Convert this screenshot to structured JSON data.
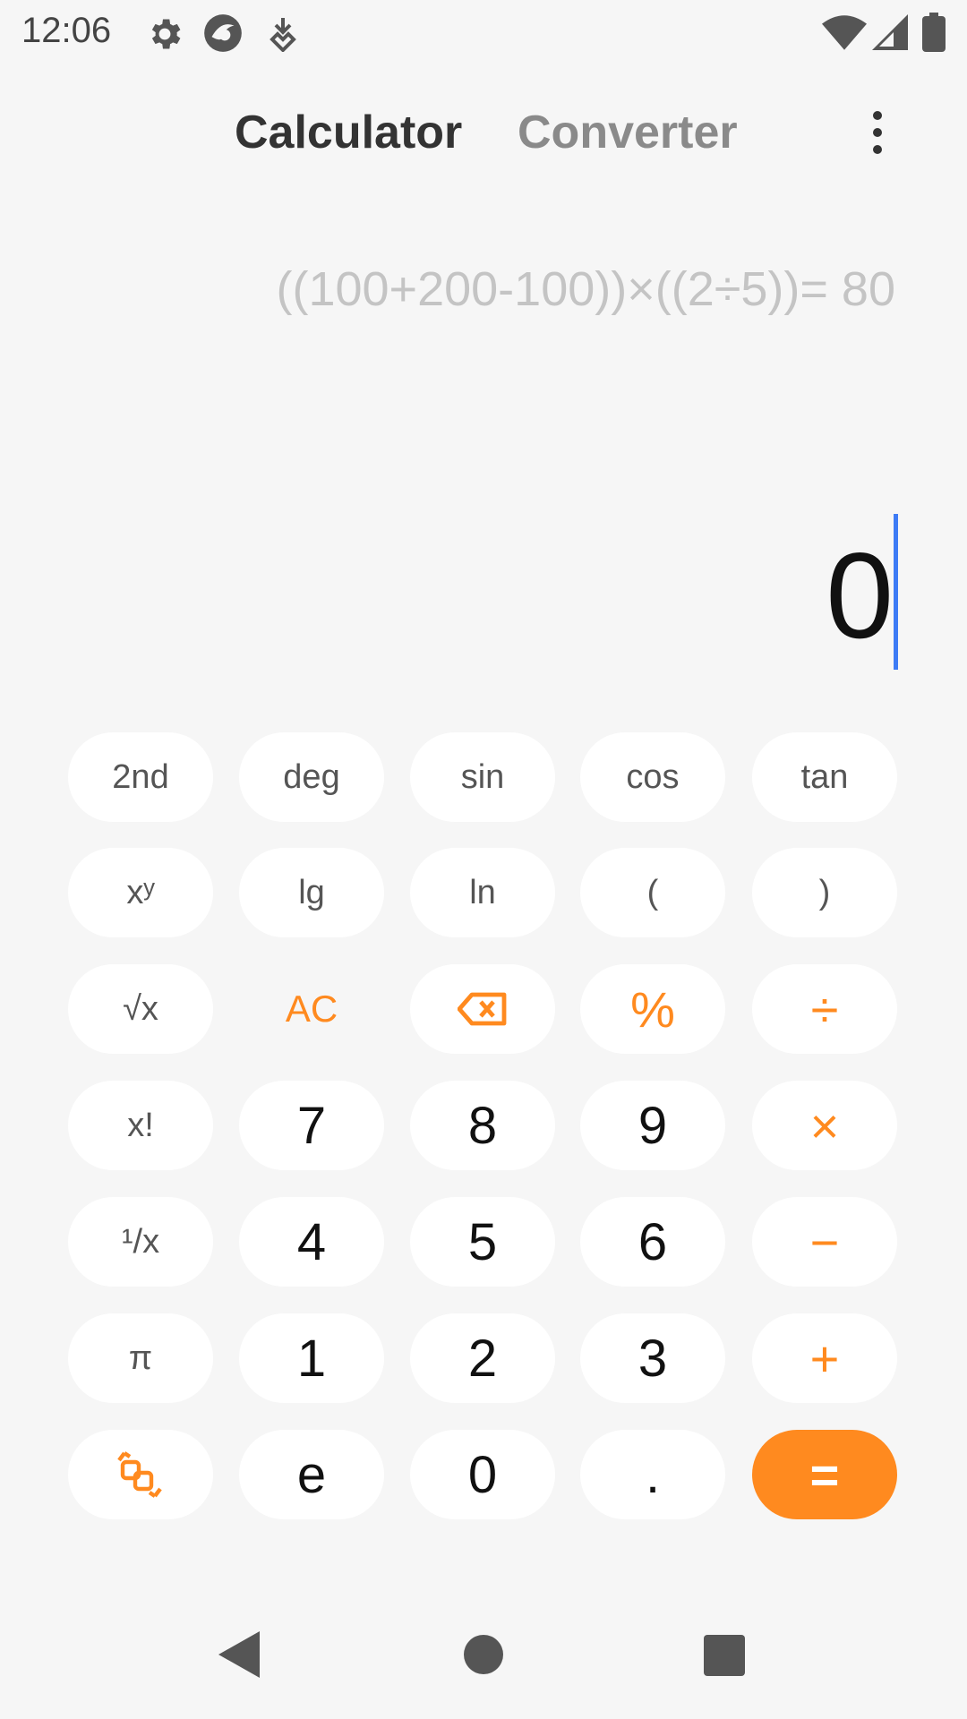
{
  "status_bar": {
    "time": "12:06",
    "icons": [
      "gear-icon",
      "browser-icon",
      "download-icon",
      "wifi-icon",
      "signal-icon",
      "battery-icon"
    ]
  },
  "tabs": [
    {
      "label": "Calculator",
      "active": true
    },
    {
      "label": "Converter",
      "active": false
    }
  ],
  "display": {
    "history": "((100+200-100))×((2÷5))= 80",
    "result": "0"
  },
  "keypad": {
    "rows": [
      [
        "2nd",
        "deg",
        "sin",
        "cos",
        "tan"
      ],
      [
        "xʸ",
        "lg",
        "ln",
        "(",
        ")"
      ],
      [
        "√x",
        "AC",
        "⌫",
        "%",
        "÷"
      ],
      [
        "x!",
        "7",
        "8",
        "9",
        "×"
      ],
      [
        "¹/x",
        "4",
        "5",
        "6",
        "−"
      ],
      [
        "π",
        "1",
        "2",
        "3",
        "+"
      ],
      [
        "⇄",
        "e",
        "0",
        ".",
        "="
      ]
    ]
  },
  "colors": {
    "accent": "#ff8a1f",
    "background": "#f6f6f6",
    "key_bg": "#ffffff",
    "cursor": "#3d7bf5",
    "history_text": "#c4c4c4"
  },
  "nav_bar": {
    "icons": [
      "back-icon",
      "home-icon",
      "recents-icon"
    ]
  }
}
